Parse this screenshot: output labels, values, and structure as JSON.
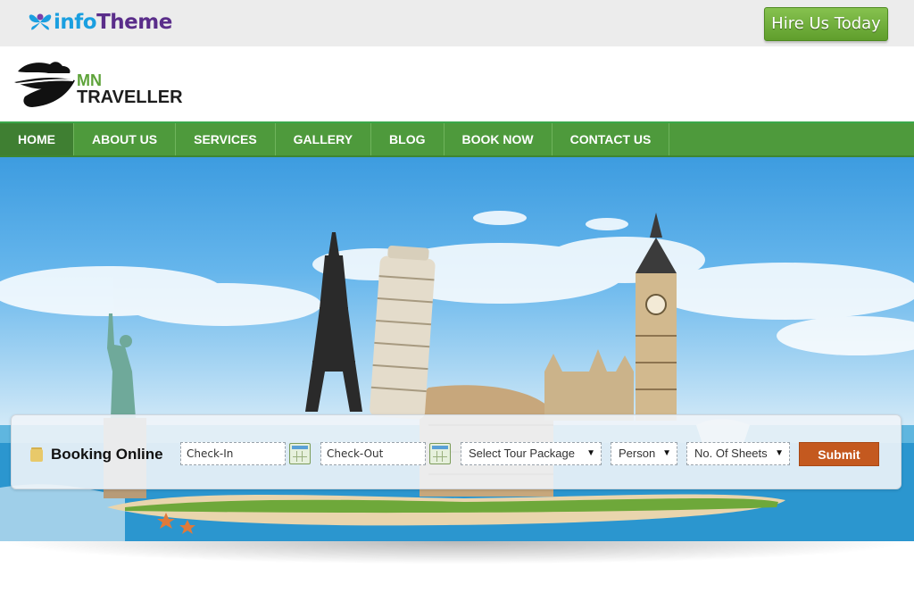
{
  "topbar": {
    "brand_prefix": "info",
    "brand_suffix": "Theme",
    "hire_label": "Hire Us Today"
  },
  "logo": {
    "line1": "MN",
    "line2": "TRAVELLER"
  },
  "nav": {
    "items": [
      "HOME",
      "ABOUT US",
      "SERVICES",
      "GALLERY",
      "BLOG",
      "BOOK NOW",
      "CONTACT US"
    ],
    "active": "HOME"
  },
  "booking": {
    "title": "Booking Online",
    "checkin_placeholder": "Check-In",
    "checkout_placeholder": "Check-Out",
    "tour_select": "Select Tour Package",
    "person_select": "Person",
    "sheets_select": "No. Of Sheets",
    "submit_label": "Submit"
  },
  "colors": {
    "nav_green": "#4e9a3c",
    "hire_green": "#6fae3c",
    "submit_orange": "#c4591f",
    "brand_purple": "#5a2d8a",
    "brand_blue": "#1a9fe0"
  },
  "icons": [
    "butterfly-logo-icon",
    "airplane-logo-icon",
    "booking-icon",
    "calendar-icon",
    "dropdown-arrow-icon"
  ]
}
